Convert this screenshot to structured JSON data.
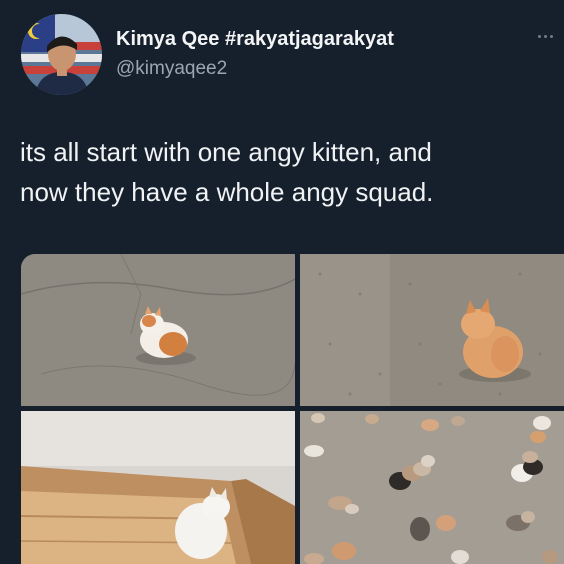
{
  "user": {
    "display_name": "Kimya Qee #rakyatjagarakyat",
    "handle": "@kimyaqee2"
  },
  "tweet": {
    "line1": "its all start with one angy kitten, and",
    "line2": "now they have a whole angy squad."
  },
  "icons": {
    "more": "more-dots-icon"
  },
  "colors": {
    "background": "#16202c",
    "text": "#f0f2f4",
    "secondary_text": "#9aa7b3"
  }
}
